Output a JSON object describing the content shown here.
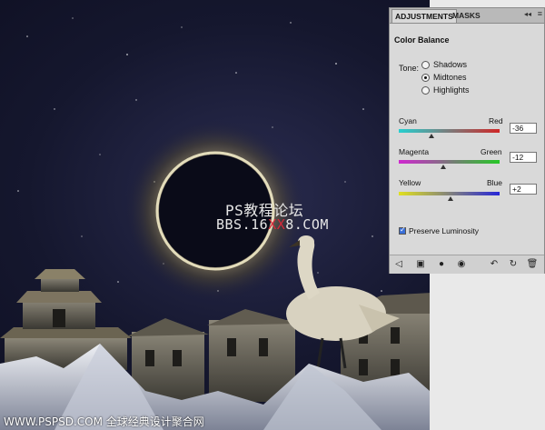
{
  "adjustments_panel": {
    "tabs": [
      {
        "label": "ADJUSTMENTS",
        "active": true
      },
      {
        "label": "MASKS",
        "active": false
      }
    ],
    "title": "Color Balance",
    "tone": {
      "label": "Tone:",
      "options": [
        {
          "label": "Shadows",
          "selected": false
        },
        {
          "label": "Midtones",
          "selected": true
        },
        {
          "label": "Highlights",
          "selected": false
        }
      ]
    },
    "sliders": [
      {
        "left_label": "Cyan",
        "right_label": "Red",
        "value": "-36",
        "level": -36
      },
      {
        "left_label": "Magenta",
        "right_label": "Green",
        "value": "-12",
        "level": -12
      },
      {
        "left_label": "Yellow",
        "right_label": "Blue",
        "value": "+2",
        "level": 2
      }
    ],
    "preserve_luminosity": {
      "label": "Preserve Luminosity",
      "checked": true
    },
    "bottom_icons": [
      "back-arrow-icon",
      "view-toggle-icon",
      "clip-layer-icon",
      "visibility-eye-icon",
      "previous-state-icon",
      "reset-icon",
      "trash-icon"
    ]
  },
  "watermark": {
    "line1": "PS教程论坛",
    "line2_a": "BBS.16",
    "line2_red": "XX",
    "line2_b": "8.COM"
  },
  "footer_text": "WWW.PSPSD.COM 全球经典设计聚合网"
}
